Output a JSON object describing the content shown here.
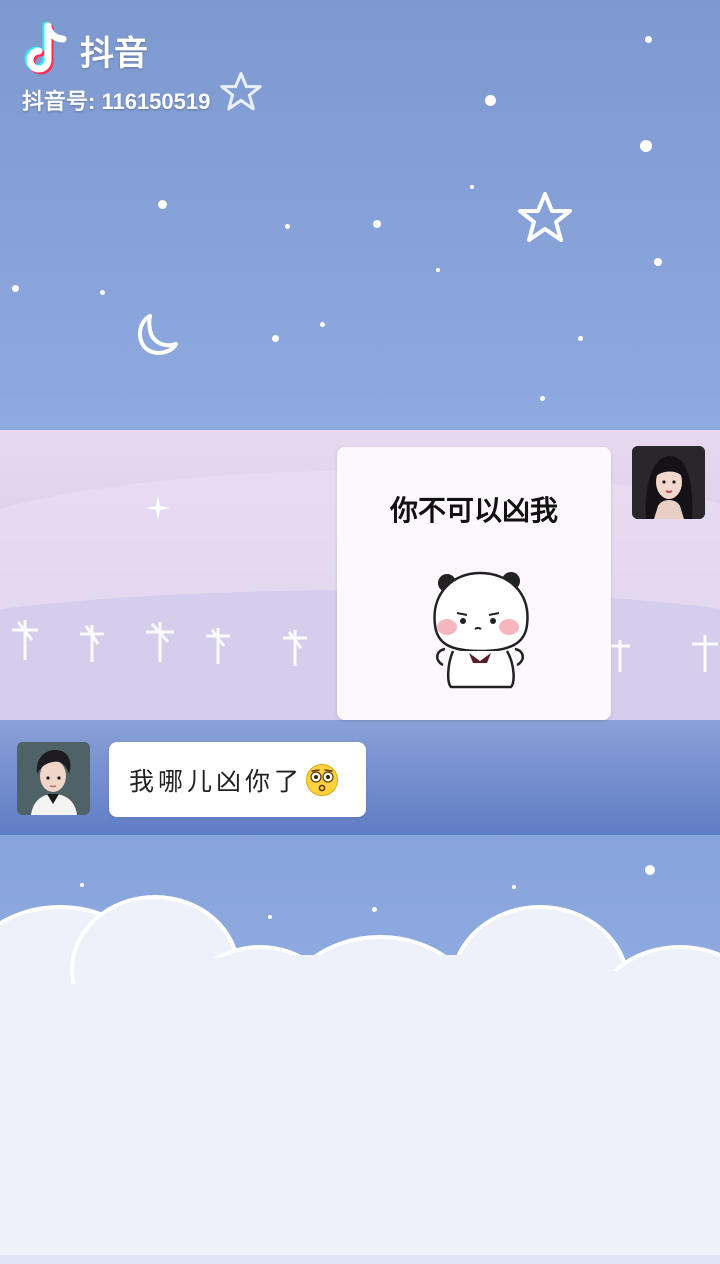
{
  "watermark": {
    "app_name": "抖音",
    "account_id": "抖音号: 116150519",
    "logo_icon": "douyin-note-icon"
  },
  "chat": {
    "messages": [
      {
        "side": "right",
        "type": "sticker",
        "caption": "你不可以凶我",
        "sticker_icon": "panda-bear-sticker"
      },
      {
        "side": "left",
        "type": "text",
        "text": "我哪儿凶你了",
        "emoji_icon": "flushed-face-emoji"
      }
    ]
  },
  "colors": {
    "sky": "#7e99d0",
    "bubble": "#ffffff",
    "douyin_cyan": "#25f4ee",
    "douyin_red": "#fe2c55"
  }
}
